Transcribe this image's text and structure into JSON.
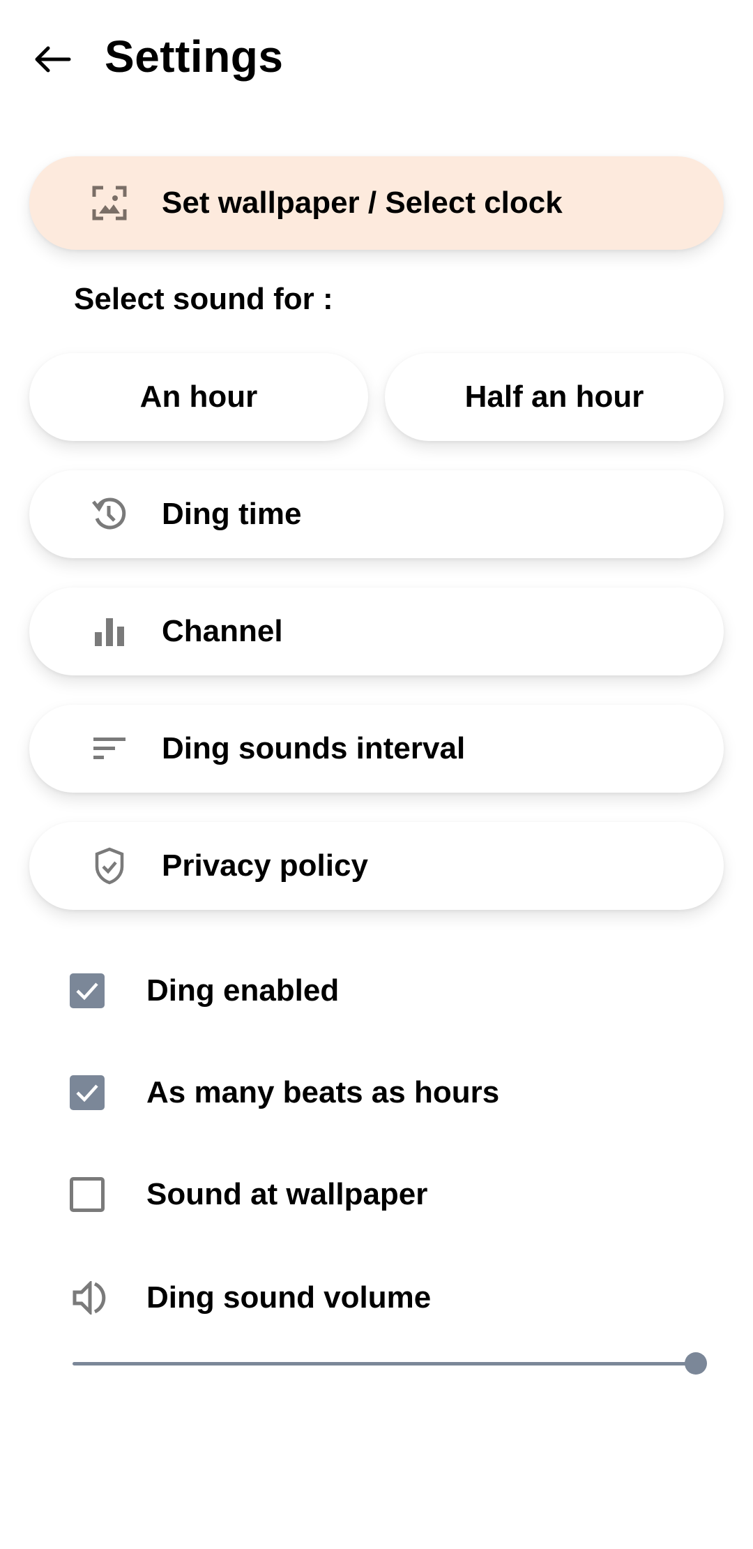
{
  "header": {
    "back_icon": "arrow-back-icon",
    "title": "Settings"
  },
  "menu": {
    "wallpaper": {
      "label": "Set wallpaper / Select clock",
      "icon": "wallpaper-icon",
      "background": "#fdeadd"
    },
    "sound_section_label": "Select sound for :",
    "sound_buttons": [
      {
        "label": "An hour"
      },
      {
        "label": "Half an hour"
      }
    ],
    "items": [
      {
        "label": "Ding time",
        "icon": "history-icon"
      },
      {
        "label": "Channel",
        "icon": "bar-chart-icon"
      },
      {
        "label": "Ding sounds interval",
        "icon": "sort-icon"
      },
      {
        "label": "Privacy policy",
        "icon": "shield-check-icon"
      }
    ]
  },
  "options": [
    {
      "label": "Ding enabled",
      "checked": true
    },
    {
      "label": "As many beats as hours",
      "checked": true
    },
    {
      "label": "Sound at wallpaper",
      "checked": false
    }
  ],
  "volume": {
    "label": "Ding sound volume",
    "icon": "volume-icon",
    "value_fraction": 1.0
  },
  "colors": {
    "accent": "#7b8798",
    "icon_gray": "#7a7a7a",
    "wallpaper_bg": "#fdeadd"
  }
}
